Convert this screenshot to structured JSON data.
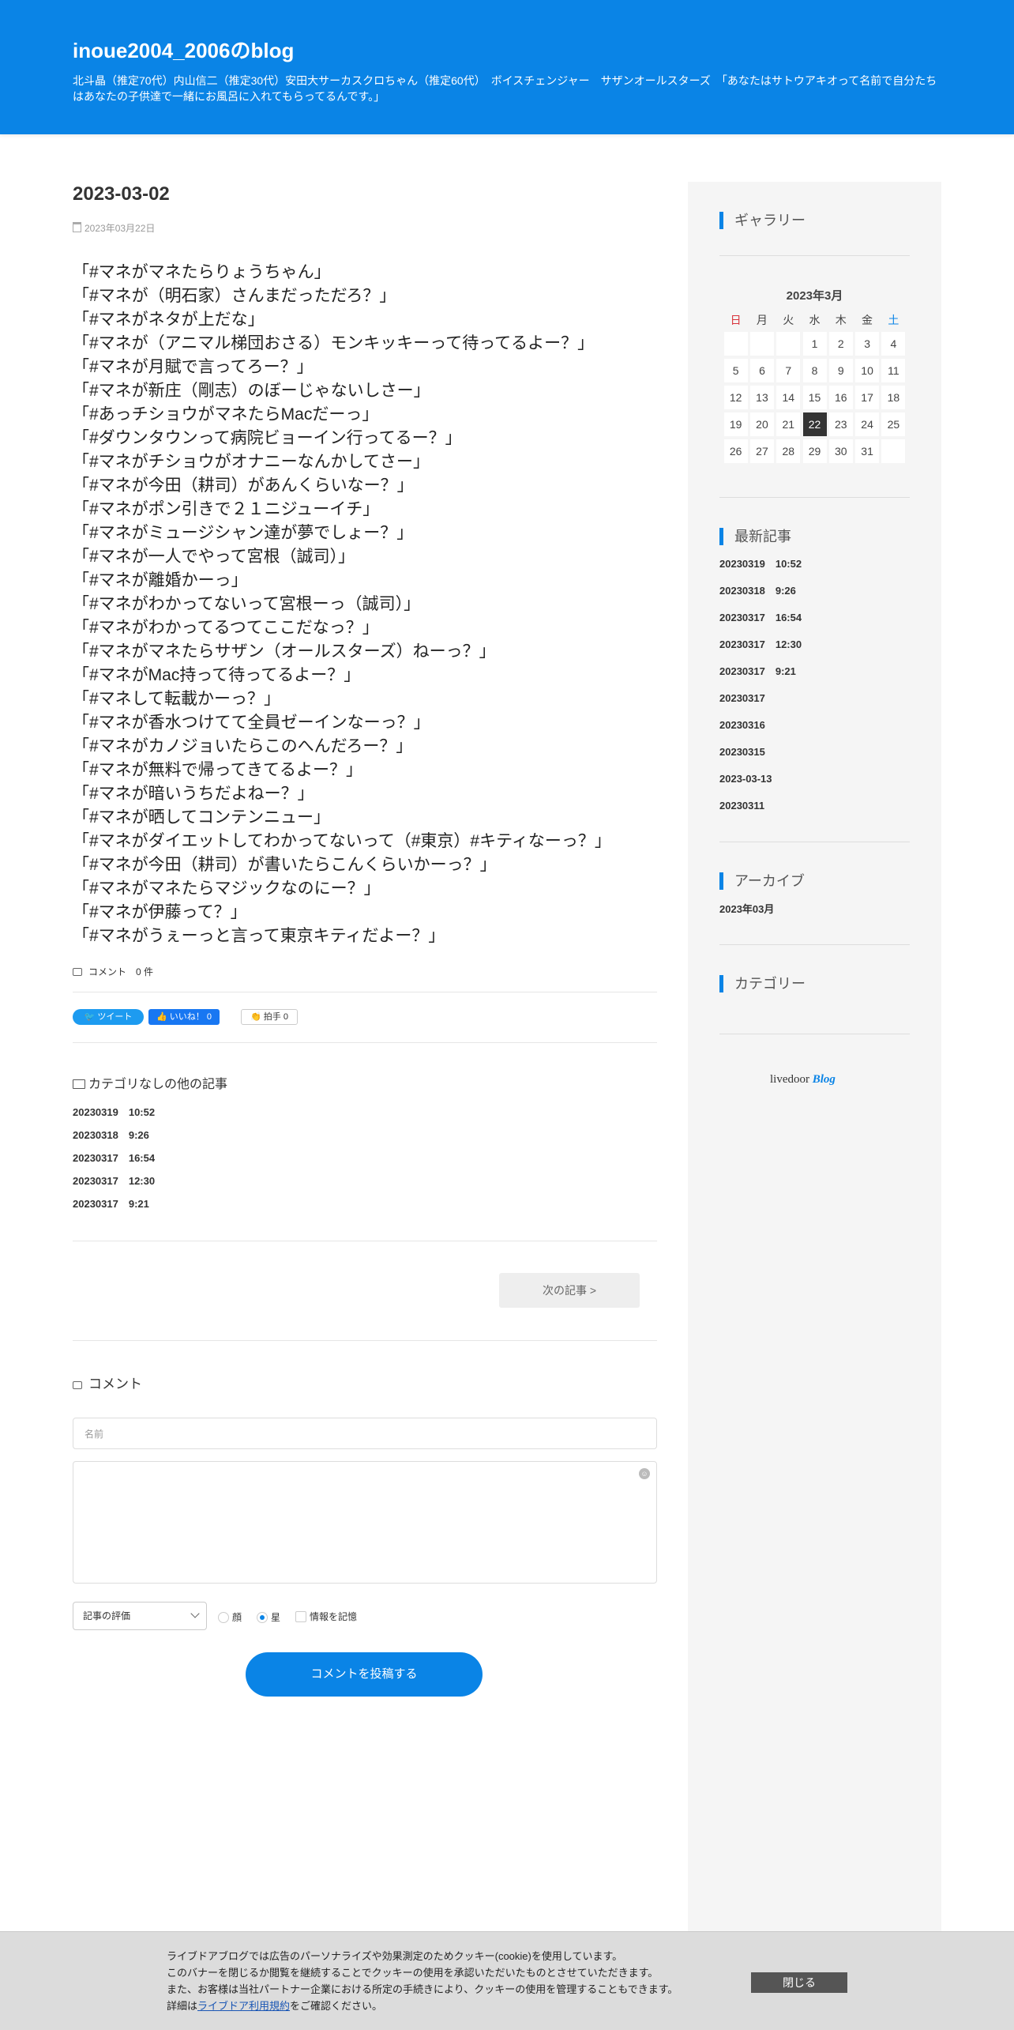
{
  "header": {
    "title": "inoue2004_2006のblog",
    "description": "北斗晶（推定70代）内山信二（推定30代）安田大サーカスクロちゃん（推定60代）　ボイスチェンジャー　サザンオールスターズ　「あなたはサトウアキオって名前で自分たちはあなたの子供達で一緒にお風呂に入れてもらってるんです。」"
  },
  "post": {
    "title": "2023-03-02",
    "date": "2023年03月22日",
    "lines": [
      "「#マネがマネたらりょうちゃん」",
      "「#マネが（明石家）さんまだっただろ？」",
      "「#マネがネタが上だな」",
      "「#マネが（アニマル梯団おさる）モンキッキーって待ってるよー？」",
      "「#マネが月賦で言ってろー？」",
      "「#マネが新庄（剛志）のぼーじゃないしさー」",
      "「#あっチショウがマネたらMacだーっ」",
      "「#ダウンタウンって病院ビョーイン行ってるー？」",
      "「#マネがチショウがオナニーなんかしてさー」",
      "「#マネが今田（耕司）があんくらいなー？」",
      "「#マネがポン引きで２１ニジューイチ」",
      "「#マネがミュージシャン達が夢でしょー？」",
      "「#マネが一人でやって宮根（誠司）」",
      "「#マネが離婚かーっ」",
      "「#マネがわかってないって宮根ーっ（誠司）」",
      "「#マネがわかってるつてここだなっ？」",
      "「#マネがマネたらサザン（オールスターズ）ねーっ？」",
      "「#マネがMac持って待ってるよー？」",
      "「#マネして転載かーっ？」",
      "「#マネが香水つけてて全員ゼーインなーっ？」",
      "「#マネがカノジョいたらこのへんだろー？」",
      "「#マネが無料で帰ってきてるよー？」",
      "「#マネが暗いうちだよねー？」",
      "「#マネが晒してコンテンニュー」",
      "「#マネがダイエットしてわかってないって（#東京）#キティなーっ？」",
      "「#マネが今田（耕司）が書いたらこんくらいかーっ？」",
      "「#マネがマネたらマジックなのにー？」",
      "「#マネが伊藤って？」",
      "「#マネがうぇーっと言って東京キティだよー？」"
    ],
    "comment_count": "コメント　0 件"
  },
  "social": {
    "tweet": "ツイート",
    "like": "いいね！ 0",
    "clap": "拍手 0"
  },
  "other_articles": {
    "heading": "カテゴリなしの他の記事",
    "items": [
      "20230319　10:52",
      "20230318　9:26",
      "20230317　16:54",
      "20230317　12:30",
      "20230317　9:21"
    ]
  },
  "next_button": "次の記事 >",
  "comment_form": {
    "heading": "コメント",
    "name_placeholder": "名前",
    "rating_select": "記事の評価",
    "radio_face": "顔",
    "radio_star": "星",
    "remember": "情報を記憶",
    "submit": "コメントを投稿する"
  },
  "sidebar": {
    "gallery_heading": "ギャラリー",
    "calendar": {
      "title": "2023年3月",
      "dow": [
        "日",
        "月",
        "火",
        "水",
        "木",
        "金",
        "土"
      ],
      "weeks": [
        [
          "",
          "",
          "",
          "1",
          "2",
          "3",
          "4"
        ],
        [
          "5",
          "6",
          "7",
          "8",
          "9",
          "10",
          "11"
        ],
        [
          "12",
          "13",
          "14",
          "15",
          "16",
          "17",
          "18"
        ],
        [
          "19",
          "20",
          "21",
          "22",
          "23",
          "24",
          "25"
        ],
        [
          "26",
          "27",
          "28",
          "29",
          "30",
          "31",
          ""
        ]
      ],
      "today": "22"
    },
    "recent_heading": "最新記事",
    "recent": [
      "20230319　10:52",
      "20230318　9:26",
      "20230317　16:54",
      "20230317　12:30",
      "20230317　9:21",
      "20230317",
      "20230316",
      "20230315",
      "2023-03-13",
      "20230311"
    ],
    "archive_heading": "アーカイブ",
    "archive_item": "2023年03月",
    "category_heading": "カテゴリー",
    "logo_text": "livedoor",
    "logo_blog": "Blog"
  },
  "cookie": {
    "line1": "ライブドアブログでは広告のパーソナライズや効果測定のためクッキー(cookie)を使用しています。",
    "line2": "このバナーを閉じるか閲覧を継続することでクッキーの使用を承認いただいたものとさせていただきます。",
    "line3": "また、お客様は当社パートナー企業における所定の手続きにより、クッキーの使用を管理することもできます。",
    "line4_prefix": "詳細は",
    "line4_link": "ライブドア利用規約",
    "line4_suffix": "をご確認ください。",
    "close": "閉じる"
  },
  "colors": {
    "header_bg": "#0a84e6",
    "accent": "#0a84e6",
    "sunday": "#d8323a",
    "saturday": "#0a84e6"
  }
}
